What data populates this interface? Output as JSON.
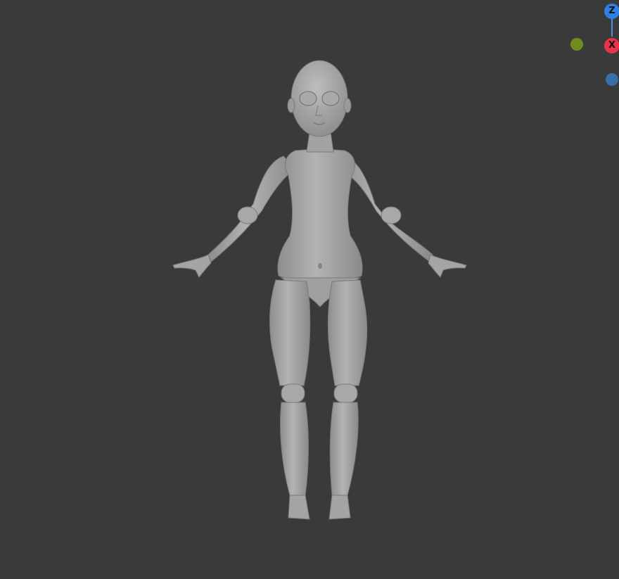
{
  "viewport": {
    "background": "#3a3a3a",
    "model_color": "#a6a6a6"
  },
  "gizmo": {
    "z_label": "Z",
    "x_label": "X",
    "z_color": "#2e7fe6",
    "x_color": "#e8334a",
    "y_color": "#6e8d1e",
    "neg_z_color": "#3a6ea8"
  }
}
